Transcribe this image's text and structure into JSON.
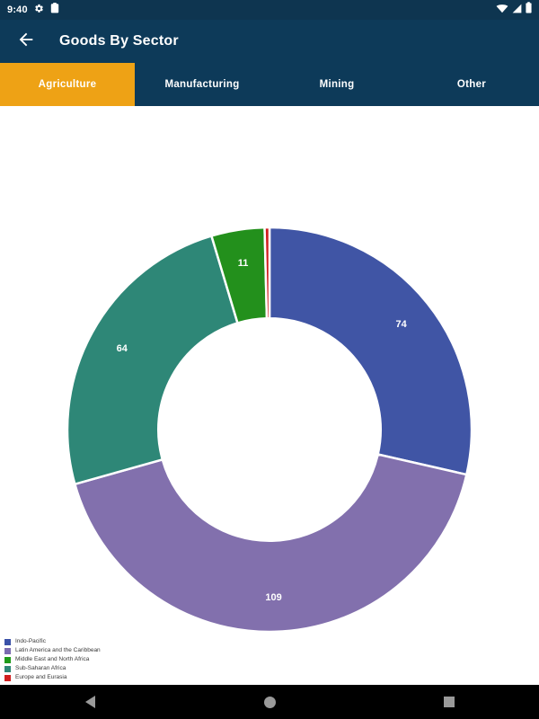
{
  "status_bar": {
    "time": "9:40",
    "left_icons": [
      "gear-icon",
      "clipboard-icon"
    ],
    "right_icons": [
      "wifi-icon",
      "cellular-signal-icon",
      "battery-icon"
    ]
  },
  "app_bar": {
    "back_icon": "arrow-left-icon",
    "title": "Goods By Sector"
  },
  "tabs": {
    "items": [
      {
        "label": "Agriculture",
        "active": true
      },
      {
        "label": "Manufacturing",
        "active": false
      },
      {
        "label": "Mining",
        "active": false
      },
      {
        "label": "Other",
        "active": false
      }
    ],
    "active_color": "#eea215",
    "bar_color": "#0d3a59"
  },
  "chart_data": {
    "type": "pie",
    "title": "",
    "subtype": "donut",
    "categories": [
      "Indo-Pacific",
      "Latin America and the Caribbean",
      "Middle East and North Africa",
      "Sub-Saharan Africa",
      "Europe and Eurasia"
    ],
    "values": [
      74,
      109,
      64,
      11,
      1
    ],
    "data_labels": [
      "74",
      "109",
      "64",
      "11",
      ""
    ],
    "colors": [
      "#4055a5",
      "#8270ad",
      "#2e8777",
      "#23901c",
      "#d01f1f"
    ],
    "legend_position": "bottom-left",
    "grid": false,
    "total": 259,
    "start_angle_deg": 90,
    "direction": "clockwise",
    "inner_radius_ratio": 0.55
  },
  "legend": {
    "items": [
      {
        "label": "Indo-Pacific",
        "color": "#3a51a8"
      },
      {
        "label": "Latin America and the Caribbean",
        "color": "#7b6bb0"
      },
      {
        "label": "Middle East and North Africa",
        "color": "#1f9b1a"
      },
      {
        "label": "Sub-Saharan Africa",
        "color": "#2e8777"
      },
      {
        "label": "Europe and Eurasia",
        "color": "#d01f1f"
      }
    ]
  },
  "nav_bar": {
    "back_label": "Back",
    "home_label": "Home",
    "recents_label": "Recents"
  }
}
